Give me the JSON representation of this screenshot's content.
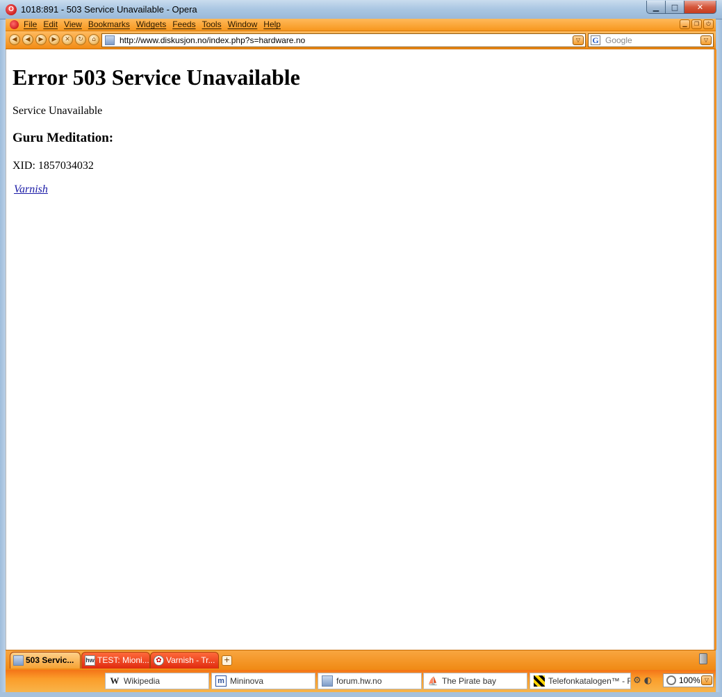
{
  "window": {
    "title": "1018:891 - 503 Service Unavailable - Opera",
    "minimize": "▁",
    "maximize": "□",
    "close": "✕"
  },
  "menu": {
    "items": [
      "File",
      "Edit",
      "View",
      "Bookmarks",
      "Widgets",
      "Feeds",
      "Tools",
      "Window",
      "Help"
    ]
  },
  "toolbar": {
    "address": "http://www.diskusjon.no/index.php?s=hardware.no",
    "search_placeholder": "Google",
    "dropdown_glyph": "▽"
  },
  "page": {
    "heading": "Error 503 Service Unavailable",
    "message": "Service Unavailable",
    "subheading": "Guru Meditation:",
    "xid": "XID: 1857034032",
    "link": "Varnish"
  },
  "tabs": [
    {
      "label": "503 Servic...",
      "active": true
    },
    {
      "label": "TEST: Mioni...",
      "active": false
    },
    {
      "label": "Varnish - Tr...",
      "active": false
    }
  ],
  "personal_bar": {
    "items": [
      "Wikipedia",
      "Mininova",
      "forum.hw.no",
      "The Pirate bay",
      "Telefonkatalogen™ - Fi"
    ],
    "zoom": "100%"
  },
  "colors": {
    "accent_orange": "#f7971e",
    "link_blue": "#1a1aa6",
    "tab_inactive_red": "#e02a10"
  }
}
